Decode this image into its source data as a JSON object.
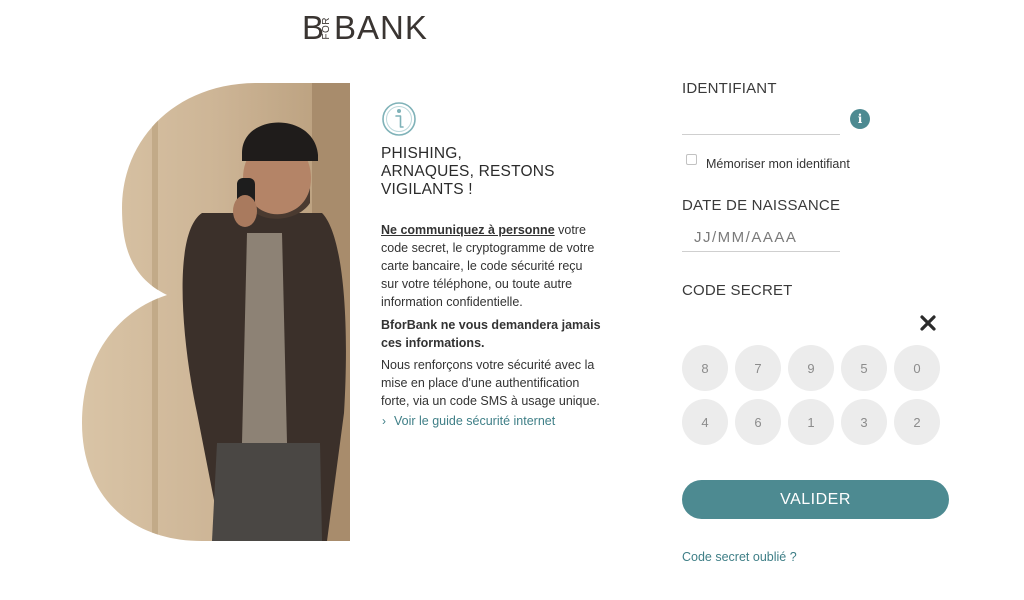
{
  "brand": {
    "logo_b": "B",
    "logo_for": "FOR",
    "logo_bank": "BANK"
  },
  "warning": {
    "title": "PHISHING,\nARNAQUES, RESTONS\nVIGILANTS !",
    "p1_strong": "Ne communiquez à personne",
    "p1_rest": " votre code secret, le cryptogramme de votre carte bancaire, le code sécurité reçu sur votre téléphone, ou toute autre information confidentielle.",
    "p2": "BforBank ne vous demandera jamais ces informations.",
    "p3": "Nous renforçons votre sécurité avec la mise en place d'une authentification forte, via un code SMS à usage unique.",
    "link_chevron": "›",
    "link_text": "Voir le guide sécurité internet"
  },
  "form": {
    "identifiant_label": "IDENTIFIANT",
    "identifiant_value": "",
    "info_icon_glyph": "i",
    "remember_label": "Mémoriser mon identifiant",
    "remember_checked": false,
    "dob_label": "DATE DE NAISSANCE",
    "dob_placeholder": "JJ/MM/AAAA",
    "code_label": "CODE SECRET",
    "keypad_row1": [
      "8",
      "7",
      "9",
      "5",
      "0"
    ],
    "keypad_row2": [
      "4",
      "6",
      "1",
      "3",
      "2"
    ],
    "submit_label": "VALIDER",
    "forgot_label": "Code secret oublié ?"
  },
  "colors": {
    "accent": "#4d8a91",
    "link": "#3f7f87",
    "key_bg": "#ececec",
    "logo": "#3a3532"
  }
}
